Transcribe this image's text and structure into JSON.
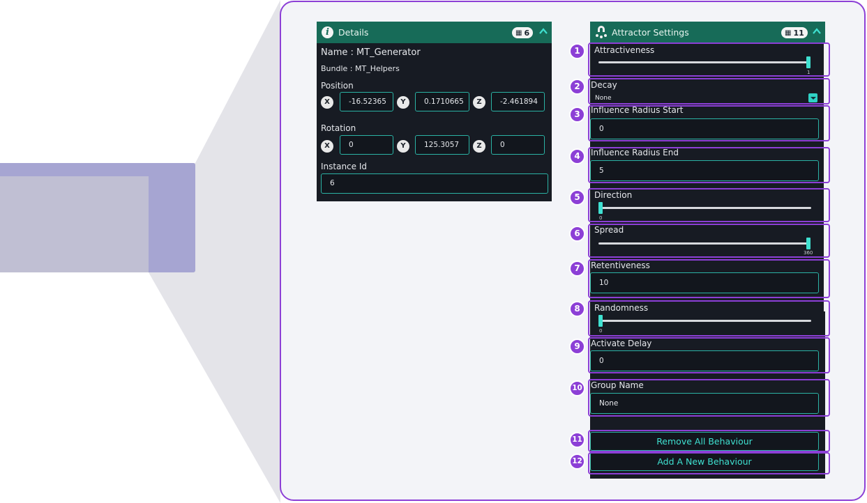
{
  "details": {
    "title": "Details",
    "badge_count": "6",
    "name_line": "Name : MT_Generator",
    "bundle_line": "Bundle : MT_Helpers",
    "position_label": "Position",
    "position": {
      "x": "-16.52365",
      "y": "0.1710665",
      "z": "-2.461894"
    },
    "rotation_label": "Rotation",
    "rotation": {
      "x": "0",
      "y": "125.3057",
      "z": "0"
    },
    "axis_labels": {
      "x": "X",
      "y": "Y",
      "z": "Z"
    },
    "instance_id_label": "Instance Id",
    "instance_id": "6"
  },
  "attractor": {
    "title": "Attractor Settings",
    "badge_count": "11",
    "attractiveness": {
      "label": "Attractiveness",
      "value": 1,
      "tick": "1"
    },
    "decay": {
      "label": "Decay",
      "value": "None"
    },
    "influence_radius_start": {
      "label": "Influence Radius Start",
      "value": "0"
    },
    "influence_radius_end": {
      "label": "Influence Radius End",
      "value": "5"
    },
    "direction": {
      "label": "Direction",
      "value": 0,
      "max": 360,
      "tick": "0"
    },
    "spread": {
      "label": "Spread",
      "value": 360,
      "max": 360,
      "tick": "360"
    },
    "retentiveness": {
      "label": "Retentiveness",
      "value": "10"
    },
    "randomness": {
      "label": "Randomness",
      "value": 0,
      "tick": "0"
    },
    "activate_delay": {
      "label": "Activate Delay",
      "value": "0"
    },
    "group_name": {
      "label": "Group Name",
      "value": "None"
    },
    "remove_all_label": "Remove All Behaviour",
    "add_new_label": "Add A New Behaviour"
  },
  "callout_numbers": [
    "1",
    "2",
    "3",
    "4",
    "5",
    "6",
    "7",
    "8",
    "9",
    "10",
    "11",
    "12"
  ],
  "colors": {
    "accent": "#8c3fd6",
    "header": "#176b58",
    "panel": "#171b23",
    "teal": "#3fe0d0"
  }
}
